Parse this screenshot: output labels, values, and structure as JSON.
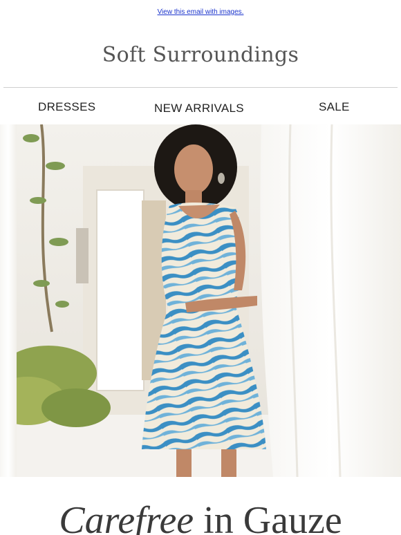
{
  "preheader": {
    "view_link": "View this email with images."
  },
  "brand": {
    "logo_text": "Soft Surroundings"
  },
  "nav": {
    "items": [
      {
        "label": "DRESSES"
      },
      {
        "label": "NEW ARRIVALS"
      },
      {
        "label": "SALE"
      }
    ]
  },
  "hero": {
    "image_name": "model-in-blue-zebra-print-dress"
  },
  "headline": {
    "emphasis": "Carefree",
    "rest": "in Gauze"
  },
  "colors": {
    "link": "#1a33cc",
    "dress_blue": "#3b8fc4",
    "dress_cream": "#f1ebdc",
    "text": "#3a3a3a"
  }
}
